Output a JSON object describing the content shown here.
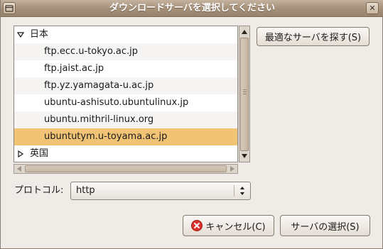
{
  "window": {
    "title": "ダウンロードサーバを選択してください",
    "close_glyph": "✕"
  },
  "tree": {
    "groups": [
      {
        "label": "日本",
        "expanded": true,
        "servers": [
          {
            "name": "ftp.ecc.u-tokyo.ac.jp"
          },
          {
            "name": "ftp.jaist.ac.jp"
          },
          {
            "name": "ftp.yz.yamagata-u.ac.jp"
          },
          {
            "name": "ubuntu-ashisuto.ubuntulinux.jp"
          },
          {
            "name": "ubuntu.mithril-linux.org"
          },
          {
            "name": "ubuntutym.u-toyama.ac.jp",
            "selected": true
          }
        ]
      },
      {
        "label": "英国",
        "expanded": false
      }
    ]
  },
  "buttons": {
    "find_best": "最適なサーバを探す(S)",
    "cancel": "キャンセル(C)",
    "select_server": "サーバの選択(S)"
  },
  "protocol": {
    "label": "プロトコル:",
    "value": "http"
  },
  "colors": {
    "selection": "#f1c374",
    "titlebar": "#a48f78",
    "window_bg": "#efebe7"
  }
}
